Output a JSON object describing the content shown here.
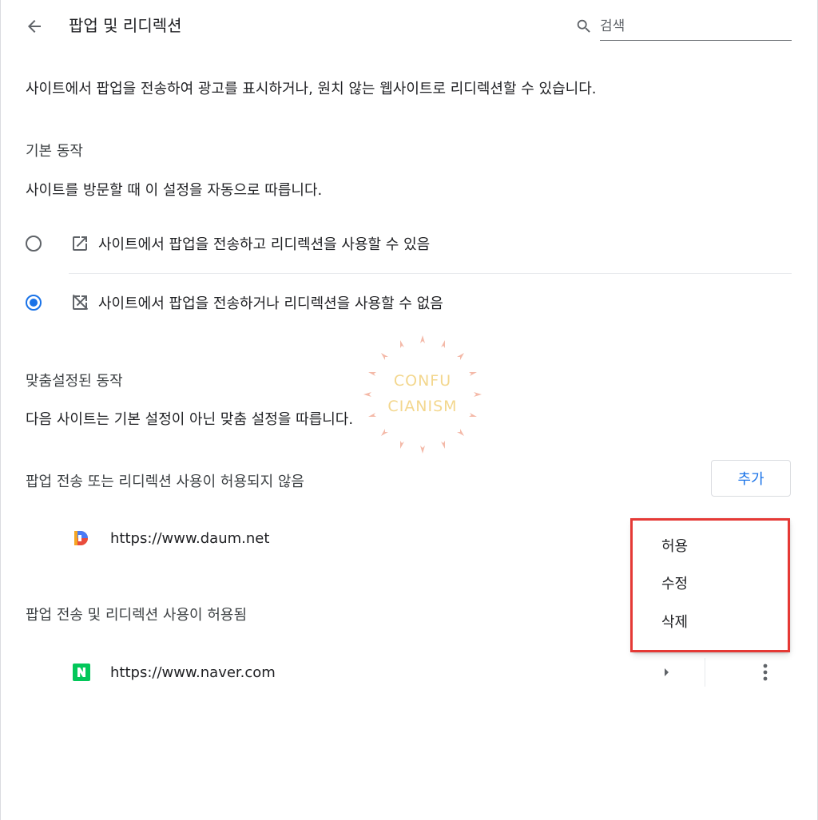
{
  "header": {
    "title": "팝업 및 리디렉션",
    "search_placeholder": "검색"
  },
  "description": "사이트에서 팝업을 전송하여 광고를 표시하거나, 원치 않는 웹사이트로 리디렉션할 수 있습니다.",
  "default_behavior": {
    "heading": "기본 동작",
    "subtext": "사이트를 방문할 때 이 설정을 자동으로 따릅니다.",
    "options": [
      {
        "label": "사이트에서 팝업을 전송하고 리디렉션을 사용할 수 있음",
        "selected": false,
        "icon": "open-in-new-icon"
      },
      {
        "label": "사이트에서 팝업을 전송하거나 리디렉션을 사용할 수 없음",
        "selected": true,
        "icon": "open-in-new-off-icon"
      }
    ]
  },
  "custom_behavior": {
    "heading": "맞춤설정된 동작",
    "subtext": "다음 사이트는 기본 설정이 아닌 맞춤 설정을 따릅니다.",
    "blocked": {
      "heading": "팝업 전송 또는 리디렉션 사용이 허용되지 않음",
      "add_label": "추가",
      "sites": [
        {
          "url": "https://www.daum.net",
          "icon": "daum-favicon"
        }
      ]
    },
    "allowed": {
      "heading": "팝업 전송 및 리디렉션 사용이 허용됨",
      "sites": [
        {
          "url": "https://www.naver.com",
          "icon": "naver-favicon"
        }
      ]
    }
  },
  "context_menu": {
    "items": [
      "허용",
      "수정",
      "삭제"
    ]
  },
  "watermark": {
    "line1": "CONFU",
    "line2": "CIANISM"
  },
  "colors": {
    "accent": "#1a73e8",
    "highlight_box": "#e53935",
    "naver_green": "#03c75a"
  }
}
